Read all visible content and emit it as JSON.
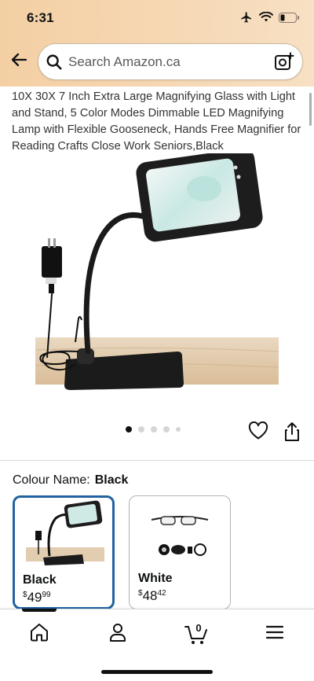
{
  "status_bar": {
    "time": "6:31"
  },
  "search": {
    "placeholder": "Search Amazon.ca"
  },
  "product": {
    "title": "10X 30X 7 Inch Extra Large Magnifying Glass with Light and Stand, 5 Color Modes Dimmable LED Magnifying Lamp with Flexible Gooseneck, Hands Free Magnifier for Reading Crafts Close Work Seniors,Black",
    "carousel": {
      "dots": 5,
      "active_index": 0
    }
  },
  "variants": {
    "label": "Colour Name:",
    "selected": "Black",
    "options": [
      {
        "name": "Black",
        "currency": "$",
        "price_whole": "49",
        "price_fraction": "99",
        "selected": true
      },
      {
        "name": "White",
        "currency": "$",
        "price_whole": "48",
        "price_fraction": "42",
        "selected": false
      }
    ]
  },
  "bottom_nav": {
    "items": [
      {
        "icon": "home-icon"
      },
      {
        "icon": "account-icon"
      },
      {
        "icon": "cart-icon",
        "count": "0"
      },
      {
        "icon": "menu-icon"
      }
    ]
  },
  "colors": {
    "selected_border": "#2162a1",
    "header_bg": "#f4cfa4"
  }
}
